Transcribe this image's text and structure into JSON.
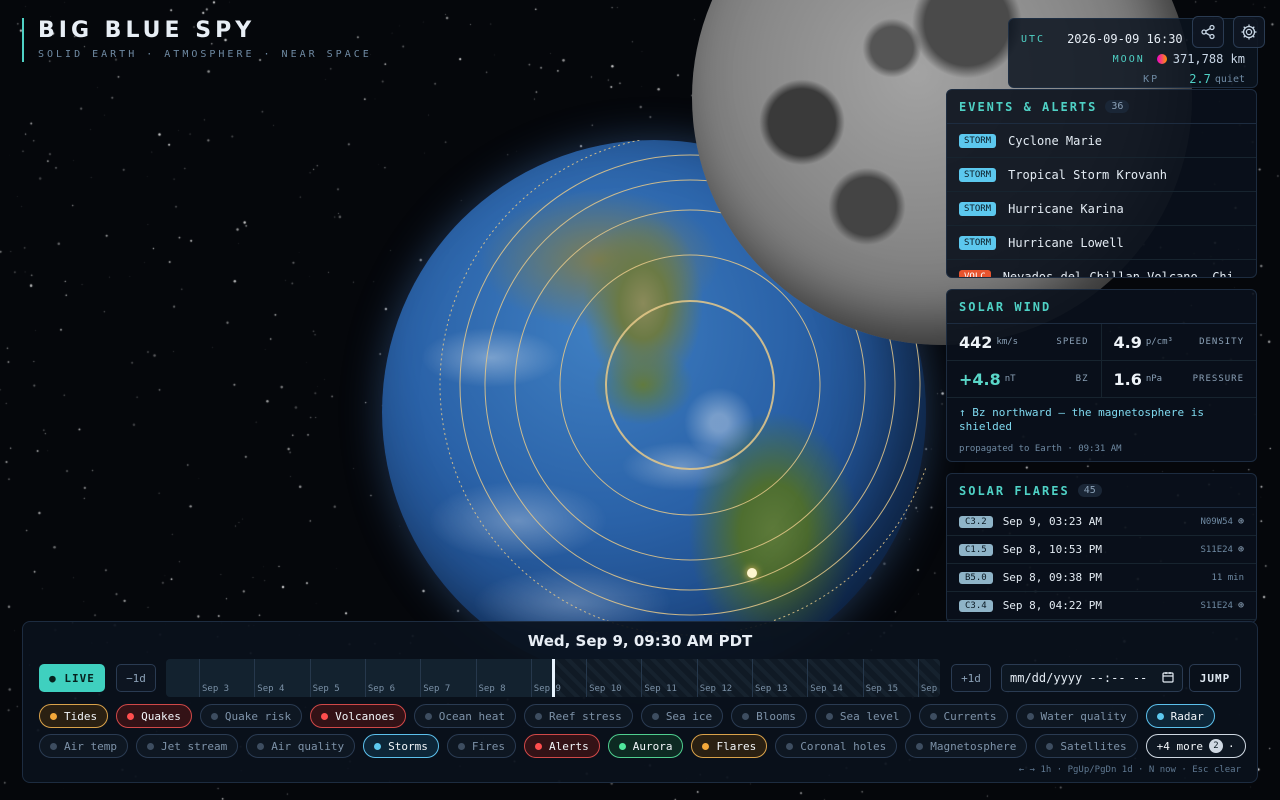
{
  "brand": {
    "title": "BIG BLUE SPY",
    "subtitle": "SOLID EARTH · ATMOSPHERE · NEAR SPACE"
  },
  "status": {
    "utc_label": "UTC",
    "utc_value": "2026-09-09 16:30",
    "moon_label": "MOON",
    "moon_distance": "371,788 km",
    "kp_label": "KP",
    "kp_value": "2.7",
    "kp_state": "quiet"
  },
  "icons": {
    "share": "share-icon",
    "settings": "gear-icon"
  },
  "alerts": {
    "title": "EVENTS & ALERTS",
    "count": "36",
    "items": [
      {
        "tag": "STORM",
        "name": "Cyclone Marie"
      },
      {
        "tag": "STORM",
        "name": "Tropical Storm Krovanh"
      },
      {
        "tag": "STORM",
        "name": "Hurricane Karina"
      },
      {
        "tag": "STORM",
        "name": "Hurricane Lowell"
      },
      {
        "tag": "VOLC",
        "name": "Nevados del Chillan Volcano, Chi"
      }
    ]
  },
  "solar_wind": {
    "title": "SOLAR WIND",
    "speed": {
      "value": "442",
      "unit": "km/s",
      "label": "SPEED"
    },
    "density": {
      "value": "4.9",
      "unit": "p/cm³",
      "label": "DENSITY"
    },
    "bz": {
      "value": "+4.8",
      "unit": "nT",
      "label": "BZ"
    },
    "pressure": {
      "value": "1.6",
      "unit": "nPa",
      "label": "PRESSURE"
    },
    "note": "↑ Bz northward — the magnetosphere is shielded",
    "propagated": "propagated to Earth · 09:31 AM"
  },
  "flares": {
    "title": "SOLAR FLARES",
    "count": "45",
    "items": [
      {
        "class": "C3.2",
        "time": "Sep 9, 03:23 AM",
        "loc": "N09W54",
        "target": "⊕"
      },
      {
        "class": "C1.5",
        "time": "Sep 8, 10:53 PM",
        "loc": "S11E24",
        "target": "⊕"
      },
      {
        "class": "B5.0",
        "time": "Sep 8, 09:38 PM",
        "loc": "11 min",
        "target": ""
      },
      {
        "class": "C3.4",
        "time": "Sep 8, 04:22 PM",
        "loc": "S11E24",
        "target": "⊕"
      }
    ]
  },
  "dock": {
    "date": "Wed, Sep 9, 09:30 AM PDT",
    "live": "● LIVE",
    "minus_day": "−1d",
    "plus_day": "+1d",
    "date_placeholder": "mm/dd/yyyy --:-- --",
    "jump": "JUMP",
    "timeline_labels": [
      "Sep 3",
      "Sep 4",
      "Sep 5",
      "Sep 6",
      "Sep 7",
      "Sep 8",
      "Sep 9",
      "Sep 10",
      "Sep 11",
      "Sep 12",
      "Sep 13",
      "Sep 14",
      "Sep 15",
      "Sep"
    ],
    "hint": "← → 1h · PgUp/PgDn 1d · N now · Esc clear"
  },
  "layers_row1": [
    {
      "label": "Tides",
      "state": "on-orange"
    },
    {
      "label": "Quakes",
      "state": "on-red"
    },
    {
      "label": "Quake risk",
      "state": "off"
    },
    {
      "label": "Volcanoes",
      "state": "on-red"
    },
    {
      "label": "Ocean heat",
      "state": "off"
    },
    {
      "label": "Reef stress",
      "state": "off"
    },
    {
      "label": "Sea ice",
      "state": "off"
    },
    {
      "label": "Blooms",
      "state": "off"
    },
    {
      "label": "Sea level",
      "state": "off"
    },
    {
      "label": "Currents",
      "state": "off"
    },
    {
      "label": "Water quality",
      "state": "off"
    },
    {
      "label": "Radar",
      "state": "on-blue"
    }
  ],
  "layers_row2": [
    {
      "label": "Air temp",
      "state": "off"
    },
    {
      "label": "Jet stream",
      "state": "off"
    },
    {
      "label": "Air quality",
      "state": "off"
    },
    {
      "label": "Storms",
      "state": "on-blue"
    },
    {
      "label": "Fires",
      "state": "off"
    },
    {
      "label": "Alerts",
      "state": "on-red"
    },
    {
      "label": "Aurora",
      "state": "on-green"
    },
    {
      "label": "Flares",
      "state": "on-orange"
    },
    {
      "label": "Coronal holes",
      "state": "off"
    },
    {
      "label": "Magnetosphere",
      "state": "off"
    },
    {
      "label": "Satellites",
      "state": "off"
    }
  ],
  "more_layers": {
    "label": "+4 more",
    "count": "2",
    "caret": "·"
  }
}
